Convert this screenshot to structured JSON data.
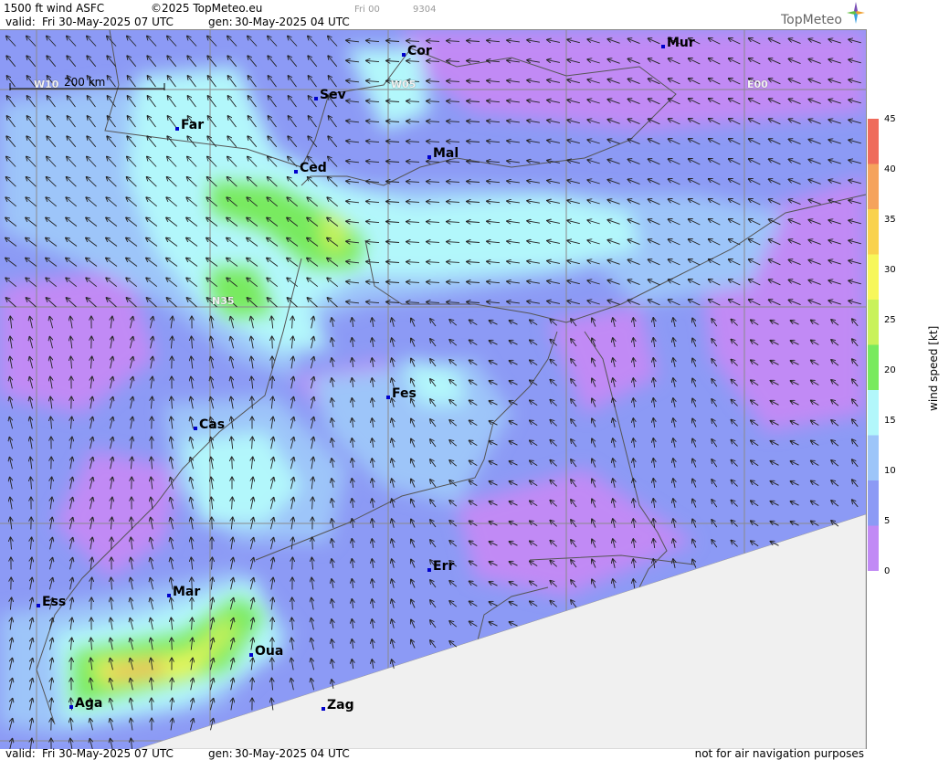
{
  "header": {
    "title": "1500 ft wind ASFC",
    "copyright": "©2025 TopMeteo.eu",
    "day_code": "Fri 00",
    "code": "9304",
    "valid_label": "valid:",
    "valid_value": "Fri  30-May-2025  07 UTC",
    "gen_label": "gen:",
    "gen_value": "30-May-2025 04 UTC",
    "logo": "TopMeteo"
  },
  "scale": {
    "label": "200 km"
  },
  "grid_labels": {
    "w10": "W10",
    "w05": "W05",
    "e00": "E00",
    "n35": "N35"
  },
  "cities": [
    {
      "name": "Cor"
    },
    {
      "name": "Mur"
    },
    {
      "name": "Sev"
    },
    {
      "name": "Far"
    },
    {
      "name": "Mal"
    },
    {
      "name": "Ced"
    },
    {
      "name": "Fes"
    },
    {
      "name": "Cas"
    },
    {
      "name": "Err"
    },
    {
      "name": "Ess"
    },
    {
      "name": "Mar"
    },
    {
      "name": "Oua"
    },
    {
      "name": "Aga"
    },
    {
      "name": "Zag"
    }
  ],
  "legend": {
    "title": "wind speed [kt]",
    "ticks": [
      "45",
      "40",
      "35",
      "30",
      "25",
      "20",
      "15",
      "10",
      "5",
      "0"
    ],
    "colors": [
      "#ef6b5b",
      "#f5a35d",
      "#f9d24d",
      "#f7f75a",
      "#c9f25a",
      "#78ea5e",
      "#b2f7fb",
      "#9dc5f9",
      "#8c9af5",
      "#c18af5"
    ]
  },
  "footer": {
    "valid_label": "valid:",
    "valid_value": "Fri  30-May-2025  07 UTC",
    "gen_label": "gen:",
    "gen_value": "30-May-2025 04 UTC",
    "disclaimer": "not for air navigation purposes"
  }
}
